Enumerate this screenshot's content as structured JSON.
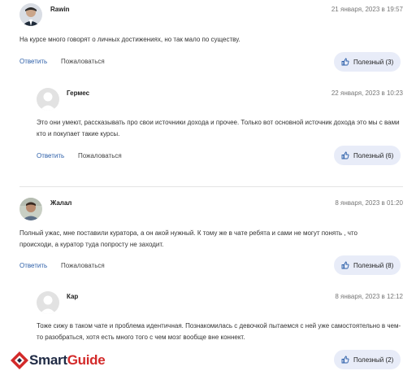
{
  "comments": [
    {
      "author": "Rawin",
      "date": "21 января, 2023 в 19:57",
      "text": "На курсе много говорят о личных достижениях, но так мало по существу.",
      "reply": "Ответить",
      "report": "Пожаловаться",
      "helpful": "Полезный (3)"
    },
    {
      "author": "Гермес",
      "date": "22 января, 2023 в 10:23",
      "text": "Это они умеют, рассказывать про свои источники дохода и прочее. Только вот основной источник дохода это мы с вами кто и покупает такие курсы.",
      "reply": "Ответить",
      "report": "Пожаловаться",
      "helpful": "Полезный (6)"
    },
    {
      "author": "Жалал",
      "date": "8 января, 2023 в 01:20",
      "text": "Полный ужас, мне поставили куратора, а он акой нужный. К тому же в чате ребята и сами не могут понять , что происходи, а куратор туда попросту не заходит.",
      "reply": "Ответить",
      "report": "Пожаловаться",
      "helpful": "Полезный (8)"
    },
    {
      "author": "Кар",
      "date": "8 января, 2023 в 12:12",
      "text": "Тоже сижу в таком чате и проблема идентичная. Познакомилась с девочкой пытаемся с ней уже самостоятельно в чем-то разобраться, хотя есть много того с чем мозг вообще вне коннект.",
      "reply": "Ответить",
      "report": "Пожаловаться",
      "helpful": "Полезный (2)"
    }
  ],
  "logo": {
    "part1": "Smart",
    "part2": "Guide"
  },
  "colors": {
    "accent": "#2b5ea8",
    "button_bg": "#e8ecf8",
    "logo_red": "#d32a2a"
  }
}
